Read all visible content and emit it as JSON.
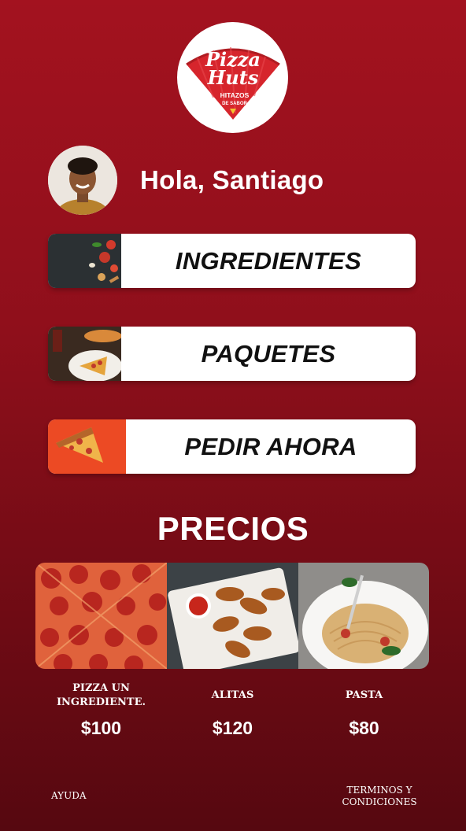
{
  "brand": {
    "name_line1": "Pizza",
    "name_line2": "Huts",
    "tagline_line1": "HITAZOS",
    "tagline_line2": "DE SABOR"
  },
  "greeting": {
    "text": "Hola, Santiago"
  },
  "menu": {
    "items": [
      {
        "label": "INGREDIENTES"
      },
      {
        "label": "PAQUETES"
      },
      {
        "label": "PEDIR AHORA"
      }
    ]
  },
  "prices": {
    "title": "PRECIOS",
    "items": [
      {
        "name": "PIZZA UN INGREDIENTE.",
        "price": "$100"
      },
      {
        "name": "ALITAS",
        "price": "$120"
      },
      {
        "name": "PASTA",
        "price": "$80"
      }
    ]
  },
  "footer": {
    "help": "AYUDA",
    "terms": "TERMINOS Y CONDICIONES"
  },
  "colors": {
    "background_top": "#a3121f",
    "background_bottom": "#560810",
    "card": "#ffffff",
    "brand_red": "#d6252c"
  }
}
